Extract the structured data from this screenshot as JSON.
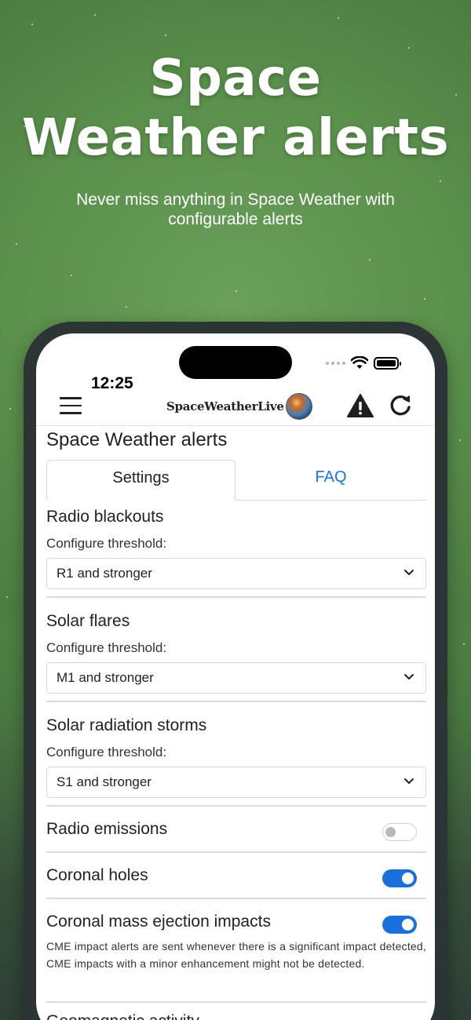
{
  "promo": {
    "headline_line1": "Space",
    "headline_line2": "Weather alerts",
    "subline": "Never miss anything in Space Weather with configurable alerts"
  },
  "status_bar": {
    "time": "12:25"
  },
  "app_bar": {
    "logo_text": "SpaceWeatherLive"
  },
  "page": {
    "title": "Space Weather alerts",
    "tabs": [
      {
        "label": "Settings",
        "active": true
      },
      {
        "label": "FAQ",
        "active": false
      }
    ]
  },
  "sections": {
    "radio_blackouts": {
      "title": "Radio blackouts",
      "sub": "Configure threshold:",
      "value": "R1 and stronger"
    },
    "solar_flares": {
      "title": "Solar flares",
      "sub": "Configure threshold:",
      "value": "M1 and stronger"
    },
    "solar_radiation": {
      "title": "Solar radiation storms",
      "sub": "Configure threshold:",
      "value": "S1 and stronger"
    }
  },
  "toggles": {
    "radio_emissions": {
      "label": "Radio emissions",
      "on": false
    },
    "coronal_holes": {
      "label": "Coronal holes",
      "on": true
    },
    "cme_impacts": {
      "label": "Coronal mass ejection impacts",
      "on": true,
      "note": "CME impact alerts are sent whenever there is a significant impact detected, CME impacts with a minor enhancement might not be detected."
    }
  },
  "cut_off_title": "Geomagnetic activity",
  "colors": {
    "accent": "#1a6fd9",
    "tab_link": "#1a73d9",
    "phone_frame": "#2c3436"
  }
}
